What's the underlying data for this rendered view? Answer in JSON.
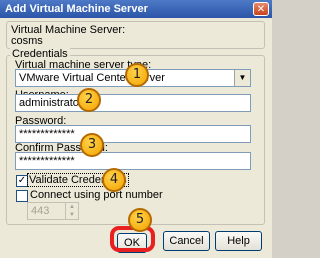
{
  "window": {
    "title": "Add Virtual Machine Server",
    "close_glyph": "✕"
  },
  "server_box": {
    "label": "Virtual Machine Server:",
    "name": "cosms"
  },
  "credentials": {
    "group_label": "Credentials",
    "server_type_label": "Virtual machine server type:",
    "server_type_value": "VMware Virtual Center Server",
    "username_label": "Username:",
    "username_value": "administrator",
    "password_label": "Password:",
    "password_value": "*************",
    "confirm_label": "Confirm Password:",
    "confirm_value": "*************",
    "validate_label": "Validate Credentials",
    "validate_checked": true,
    "port_label": "Connect using port number",
    "port_checked": false,
    "port_value": "443"
  },
  "buttons": {
    "ok": "OK",
    "cancel": "Cancel",
    "help": "Help"
  },
  "callouts": [
    "1",
    "2",
    "3",
    "4",
    "5"
  ],
  "colors": {
    "callout_fill": "#f4a300",
    "highlight_ring": "#e82020",
    "titlebar": "#2b55a8"
  }
}
